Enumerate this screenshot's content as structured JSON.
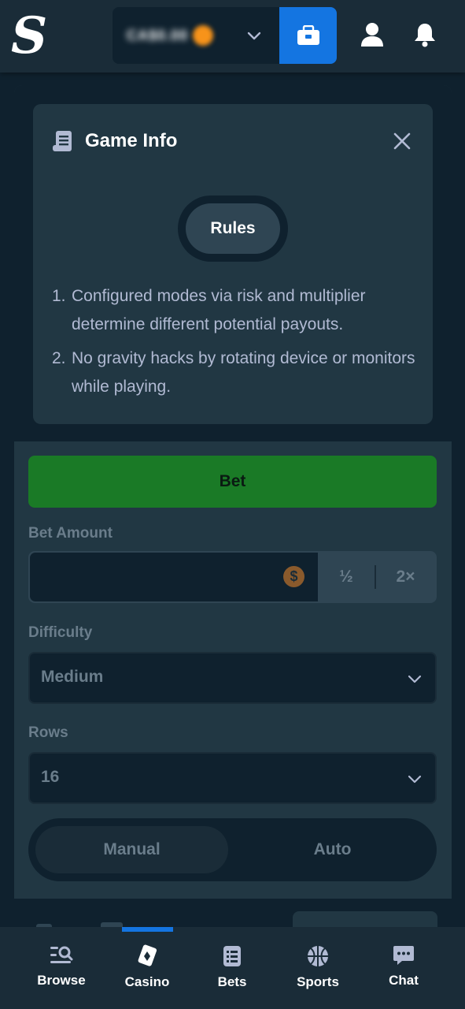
{
  "header": {
    "logo": "S",
    "wallet_balance": "CA$0.00",
    "colors": {
      "accent": "#1475e1",
      "bg": "#1a2c38"
    },
    "icons": [
      "wallet-icon",
      "user-icon",
      "bell-icon"
    ]
  },
  "game_info": {
    "title": "Game Info",
    "tab_label": "Rules",
    "rules": [
      {
        "num": "1.",
        "text": "Configured modes via risk and multiplier determine different potential payouts."
      },
      {
        "num": "2.",
        "text": "No gravity hacks by rotating device or monitors while playing."
      }
    ]
  },
  "controls": {
    "bet_button": "Bet",
    "bet_amount_label": "Bet Amount",
    "amount_value": "",
    "currency_symbol": "$",
    "half_label": "½",
    "double_label": "2×",
    "difficulty_label": "Difficulty",
    "difficulty_value": "Medium",
    "rows_label": "Rows",
    "rows_value": "16",
    "mode_tabs": [
      "Manual",
      "Auto"
    ],
    "bet_color": "#1a7a26"
  },
  "bottom_nav": {
    "items": [
      {
        "label": "Browse",
        "icon": "browse-icon"
      },
      {
        "label": "Casino",
        "icon": "casino-icon"
      },
      {
        "label": "Bets",
        "icon": "bets-icon"
      },
      {
        "label": "Sports",
        "icon": "sports-icon"
      },
      {
        "label": "Chat",
        "icon": "chat-icon"
      }
    ],
    "active": "Casino"
  }
}
